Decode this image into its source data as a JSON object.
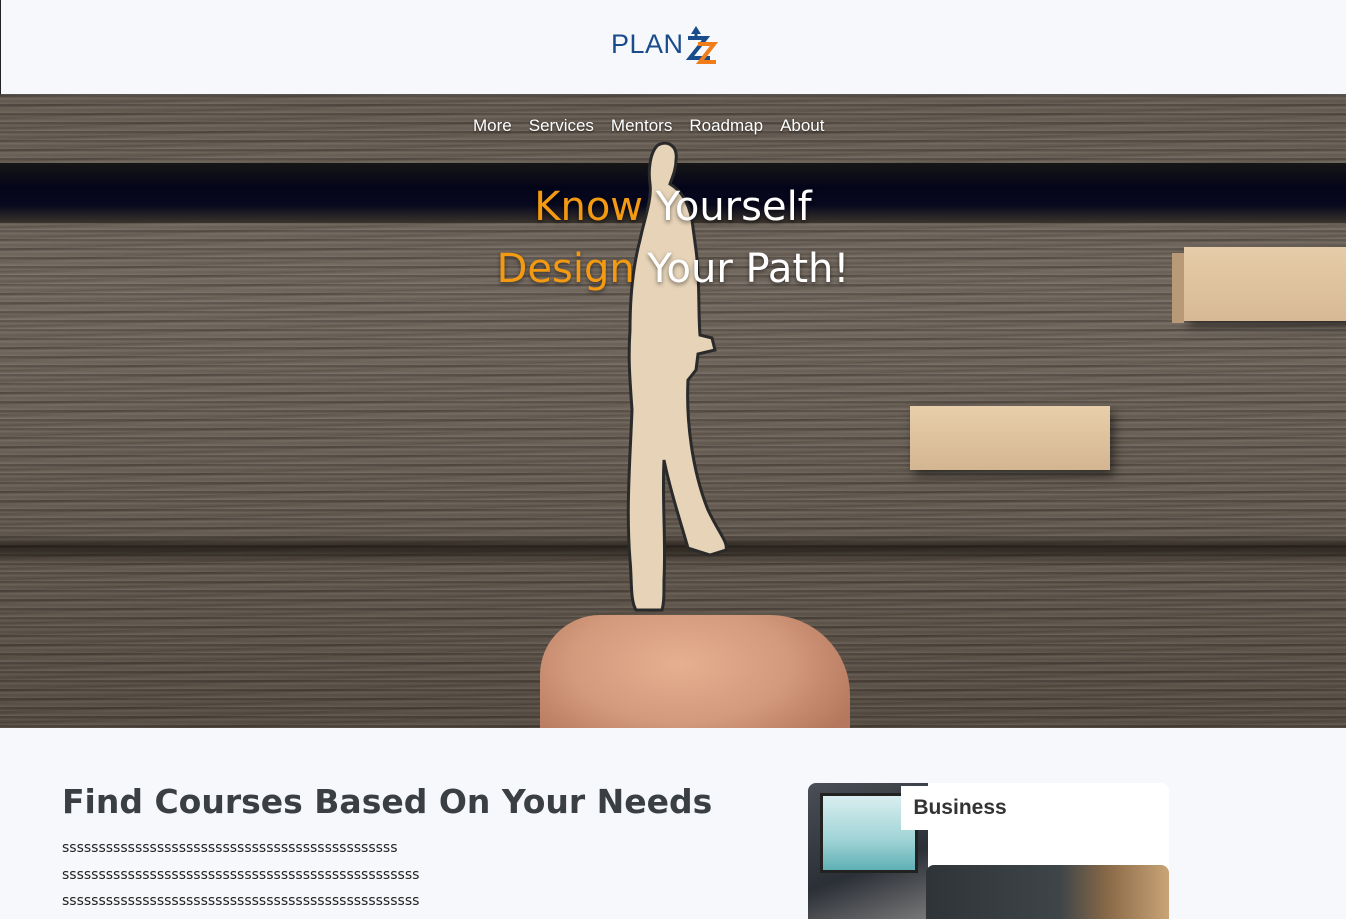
{
  "header": {
    "logo_text": "PLAN",
    "logo_colors": {
      "text": "#1a4c8c",
      "mark_blue": "#1a4c8c",
      "mark_orange": "#f07d1a"
    }
  },
  "nav": {
    "items": [
      "More",
      "Services",
      "Mentors",
      "Roadmap",
      "About"
    ]
  },
  "hero": {
    "line1_accent": "Know",
    "line1_rest": " Yourself",
    "line2_accent": "Design",
    "line2_rest": " Your Path!",
    "accent_color": "#f39a12"
  },
  "section": {
    "title": "Find Courses Based On Your Needs",
    "paragraph_lines": [
      "ssssssssssssssssssssssssssssssssssssssssssssss",
      "sssssssssssssssssssssssssssssssssssssssssssssssss",
      "sssssssssssssssssssssssssssssssssssssssssssssssss"
    ]
  },
  "card": {
    "badge": "Business"
  }
}
